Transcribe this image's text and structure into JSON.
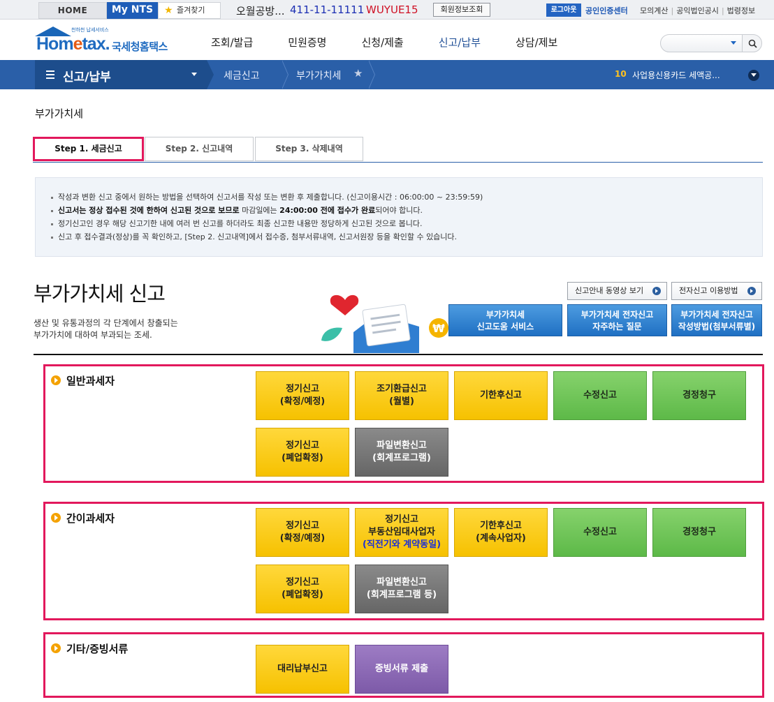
{
  "topbar": {
    "home": "HOME",
    "mynts": "My NTS",
    "favorites": "즐겨찾기",
    "user_name": "오월공방...",
    "phone": "411-11-11111",
    "user_id": "WUYUE15",
    "member_info": "회원정보조회",
    "logout": "로그아웃",
    "cert_center": "공인인증센터",
    "links": [
      "모의계산",
      "공익법인공시",
      "법령정보"
    ]
  },
  "header": {
    "logo_tagline": "천하천 납세서비스",
    "logo_word_a": "Hom",
    "logo_word_e": "e",
    "logo_word_b": "tax.",
    "logo_korean": "국세청홈택스",
    "gnb": [
      "조회/발급",
      "민원증명",
      "신청/제출",
      "신고/납부",
      "상담/제보"
    ],
    "search_placeholder": ""
  },
  "navbar": {
    "main_menu": "신고/납부",
    "crumb_1": "세금신고",
    "crumb_2": "부가가치세",
    "rank": "10",
    "rank_text": "사업용신용카드 세액공..."
  },
  "page": {
    "title": "부가가치세",
    "tabs": [
      "Step 1. 세금신고",
      "Step 2. 신고내역",
      "Step 3. 삭제내역"
    ]
  },
  "info": {
    "line1": "작성과 변환 신고 중에서 원하는 방법을 선택하여 신고서를 작성 또는 변환 후 제출합니다. (신고이용시간 : 06:00:00 ~ 23:59:59)",
    "line2_bold_a": "신고서는 정상 접수된 것에 한하여 신고된 것으로 보므로",
    "line2_mid": " 마감일에는 ",
    "line2_bold_b": "24:00:00 전에 접수가 완료",
    "line2_end": "되어야 합니다.",
    "line3": "정기신고인 경우 해당 신고기한 내에 여러 번 신고를 하더라도 최종 신고한 내용만 정당하게 신고된 것으로 봅니다.",
    "line4": "신고 후 접수결과(정상)를 꼭 확인하고, [Step 2. 신고내역]에서 접수증, 첨부서류내역, 신고서원장 등을 확인할 수 있습니다."
  },
  "section": {
    "title": "부가가치세 신고",
    "desc1": "생산 및 유통과정의 각 단계에서 창출되는",
    "desc2": "부가가치에 대하여 부과되는 조세.",
    "link_video": "신고안내 동영상 보기",
    "link_howto": "전자신고 이용방법",
    "help_1": "부가가치세\n신고도움 서비스",
    "help_2": "부가가치세 전자신고\n자주하는 질문",
    "help_3": "부가가치세 전자신고\n작성방법(첨부서류별)",
    "won_symbol": "₩"
  },
  "groups": {
    "general": {
      "label": "일반과세자",
      "tiles": [
        {
          "l1": "정기신고",
          "l2": "(확정/예정)"
        },
        {
          "l1": "조기환급신고",
          "l2": "(월별)"
        },
        {
          "l1": "기한후신고",
          "l2": ""
        },
        {
          "l1": "수정신고",
          "l2": ""
        },
        {
          "l1": "경정청구",
          "l2": ""
        },
        {
          "l1": "정기신고",
          "l2": "(폐업확정)"
        },
        {
          "l1": "파일변환신고",
          "l2": "(회계프로그램)"
        }
      ]
    },
    "simple": {
      "label": "간이과세자",
      "tiles": [
        {
          "l1": "정기신고",
          "l2": "(확정/예정)"
        },
        {
          "l1": "정기신고",
          "l2": "부동산임대사업자",
          "l3": "(직전기와 계약동일)"
        },
        {
          "l1": "기한후신고",
          "l2": "(계속사업자)"
        },
        {
          "l1": "수정신고",
          "l2": ""
        },
        {
          "l1": "경정청구",
          "l2": ""
        },
        {
          "l1": "정기신고",
          "l2": "(폐업확정)"
        },
        {
          "l1": "파일변환신고",
          "l2": "(회계프로그램 등)"
        }
      ]
    },
    "other": {
      "label": "기타/증빙서류",
      "tiles": [
        {
          "l1": "대리납부신고"
        },
        {
          "l1": "증빙서류 제출"
        }
      ]
    }
  },
  "colors": {
    "brand_blue": "#2a5fa8",
    "highlight": "#e2185c",
    "tile_yellow": "#f6c100",
    "tile_green": "#5db948",
    "tile_gray": "#666666",
    "tile_purple": "#7d5aa8"
  }
}
